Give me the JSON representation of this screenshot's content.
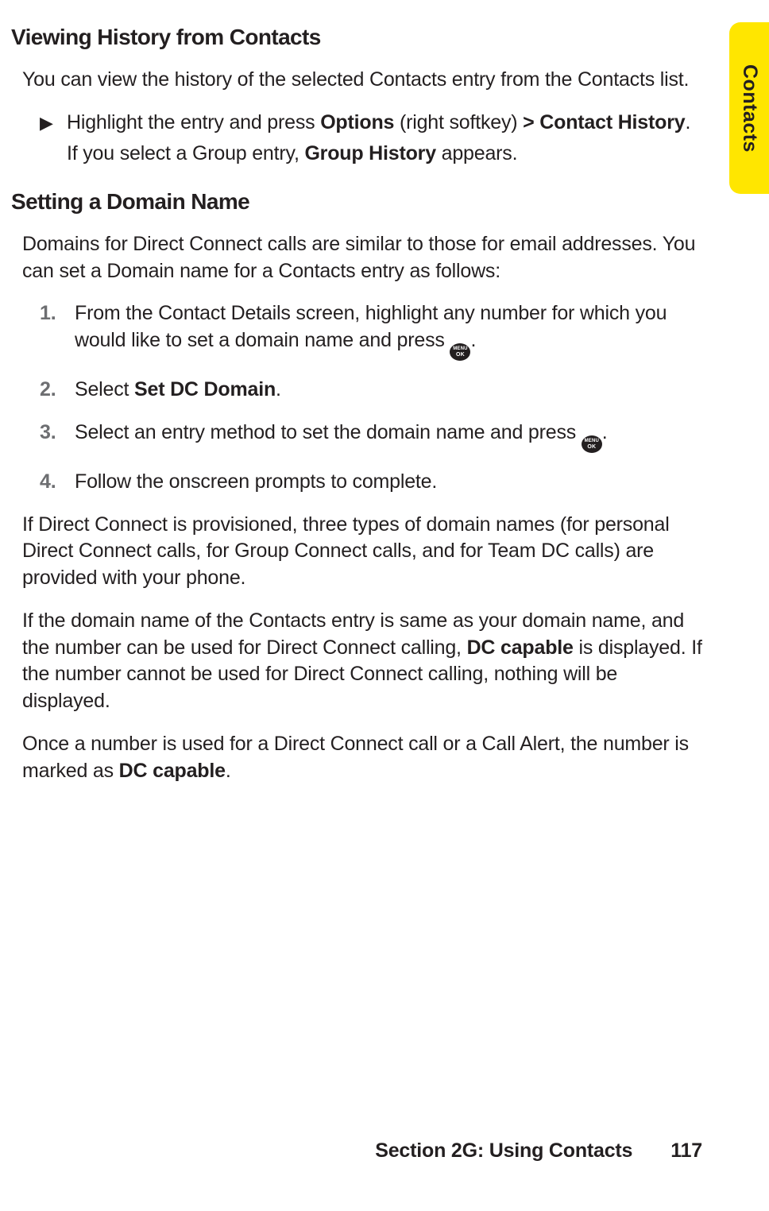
{
  "tab": {
    "label": "Contacts"
  },
  "section1": {
    "heading": "Viewing History from Contacts",
    "intro": "You can view the history of the selected Contacts entry from the Contacts list.",
    "bullet": {
      "marker": "▶",
      "line1_a": "Highlight the entry and press ",
      "line1_b": "Options",
      "line1_c": " (right softkey) ",
      "line1_d": "> Contact History",
      "line1_e": ".",
      "line2_a": "If you select a Group entry, ",
      "line2_b": "Group History",
      "line2_c": " appears."
    }
  },
  "section2": {
    "heading": "Setting a Domain Name",
    "intro": "Domains for Direct Connect calls are similar to those for email addresses. You can set a Domain name for a Contacts entry as follows:",
    "steps": {
      "s1": {
        "num": "1.",
        "a": "From the Contact Details screen, highlight any number for which you would like to set a domain name and press ",
        "b": "."
      },
      "s2": {
        "num": "2.",
        "a": "Select ",
        "b": "Set DC Domain",
        "c": "."
      },
      "s3": {
        "num": "3.",
        "a": "Select an entry method to set the domain name and press ",
        "b": "."
      },
      "s4": {
        "num": "4.",
        "a": "Follow the onscreen prompts to complete."
      }
    },
    "p1": "If Direct Connect is provisioned, three types of domain names (for personal Direct Connect calls, for Group Connect calls, and for Team DC calls) are provided with your phone.",
    "p2_a": "If the domain name of the Contacts entry is same as your domain name, and the number can be used for Direct Connect calling, ",
    "p2_b": "DC capable",
    "p2_c": " is displayed. If the number cannot be used for Direct Connect calling, nothing will be displayed.",
    "p3_a": "Once a number is used for a Direct Connect call or a Call Alert, the number is marked as ",
    "p3_b": "DC capable",
    "p3_c": "."
  },
  "menuok": {
    "l1": "MENU",
    "l2": "OK"
  },
  "footer": {
    "section": "Section 2G: Using Contacts",
    "page": "117"
  }
}
